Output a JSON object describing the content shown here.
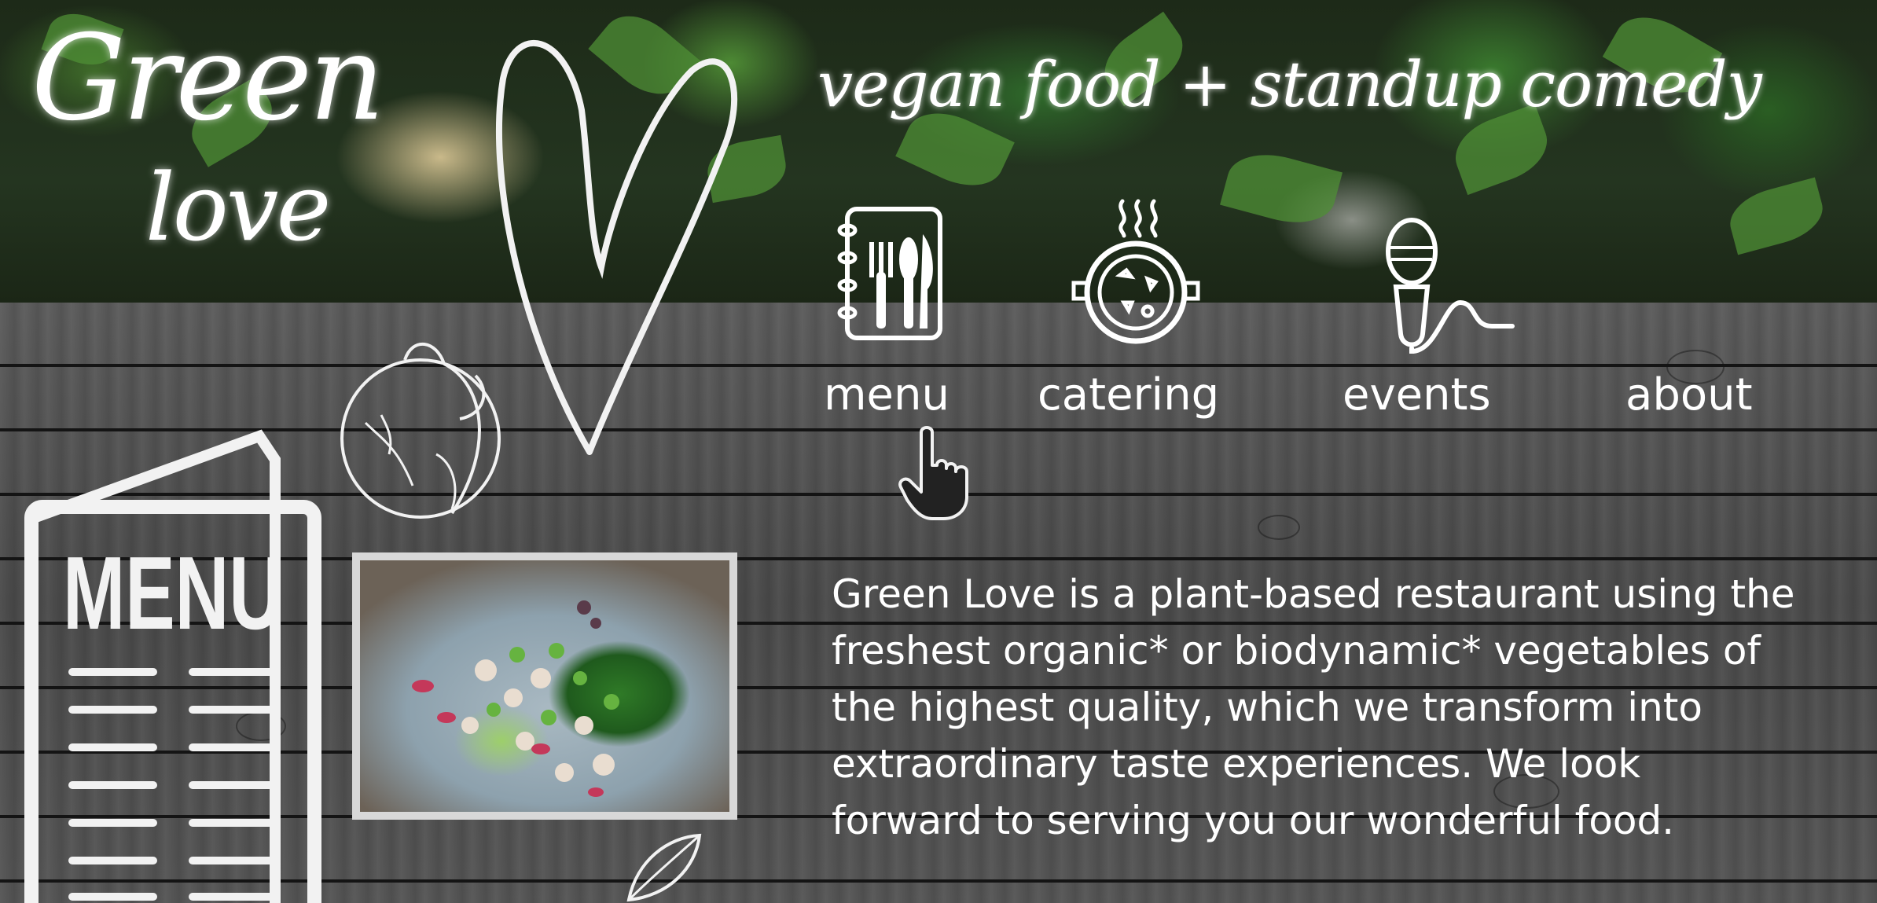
{
  "brand": {
    "logo_line1": "Green",
    "logo_line2": "love",
    "tagline": "vegan food + standup comedy"
  },
  "nav": {
    "items": [
      {
        "label": "menu",
        "icon": "menu-book-icon"
      },
      {
        "label": "catering",
        "icon": "soup-pot-icon"
      },
      {
        "label": "events",
        "icon": "microphone-icon"
      },
      {
        "label": "about",
        "icon": ""
      }
    ]
  },
  "menu_card": {
    "title": "MENU"
  },
  "intro": {
    "text": "Green Love is a plant-based restaurant using the freshest organic* or biodynamic* vegetables of the highest quality, which we transform into extraordinary taste experiences.  We look forward to serving you our wonderful food."
  },
  "colors": {
    "text": "#ffffff",
    "wood": "#4f4f4f",
    "foliage": "#2f6a2b"
  }
}
